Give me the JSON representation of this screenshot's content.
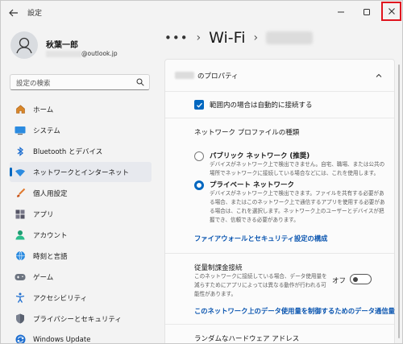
{
  "window": {
    "app_title": "設定"
  },
  "profile": {
    "name": "秋葉一郎",
    "email_suffix": "@outlook.jp"
  },
  "search": {
    "placeholder": "設定の検索"
  },
  "nav": {
    "items": [
      {
        "label": "ホーム",
        "icon": "home-icon"
      },
      {
        "label": "システム",
        "icon": "system-icon"
      },
      {
        "label": "Bluetooth とデバイス",
        "icon": "bluetooth-icon"
      },
      {
        "label": "ネットワークとインターネット",
        "icon": "wifi-icon",
        "active": true
      },
      {
        "label": "個人用設定",
        "icon": "brush-icon"
      },
      {
        "label": "アプリ",
        "icon": "apps-icon"
      },
      {
        "label": "アカウント",
        "icon": "account-icon"
      },
      {
        "label": "時刻と言語",
        "icon": "globe-clock-icon"
      },
      {
        "label": "ゲーム",
        "icon": "gamepad-icon"
      },
      {
        "label": "アクセシビリティ",
        "icon": "accessibility-icon"
      },
      {
        "label": "プライバシーとセキュリティ",
        "icon": "shield-icon"
      },
      {
        "label": "Windows Update",
        "icon": "update-icon"
      }
    ]
  },
  "breadcrumb": {
    "dots": "•••",
    "separator": "›",
    "title": "Wi-Fi"
  },
  "panel": {
    "header_title": "のプロパティ",
    "auto_connect_label": "範囲内の場合は自動的に接続する",
    "auto_connect_checked": true,
    "profile_type_label": "ネットワーク プロファイルの種類",
    "public": {
      "title": "パブリック ネットワーク (推奨)",
      "desc": "デバイスがネットワーク上で検出できません。自宅、職場、または公共の場所でネットワークに接続している場合などには、これを使用します。"
    },
    "private": {
      "title": "プライベート ネットワーク",
      "desc": "デバイスがネットワーク上で検出できます。ファイルを共有する必要がある場合、またはこのネットワーク上で通信するアプリを使用する必要がある場合は、これを選択します。ネットワーク上のユーザーとデバイスが把握でき、信頼できる必要があります。",
      "selected": true
    },
    "firewall_link": "ファイアウォールとセキュリティ設定の構成",
    "metered": {
      "title": "従量制課金接続",
      "desc": "このネットワークに接続している場合、データ使用量を減らすためにアプリによっては異なる動作が行われる可能性があります。",
      "toggle_label": "オフ",
      "on": false
    },
    "data_limit_link": "このネットワーク上のデータ使用量を制御するためのデータ通信量",
    "random_hw_label": "ランダムなハードウェア アドレス"
  }
}
